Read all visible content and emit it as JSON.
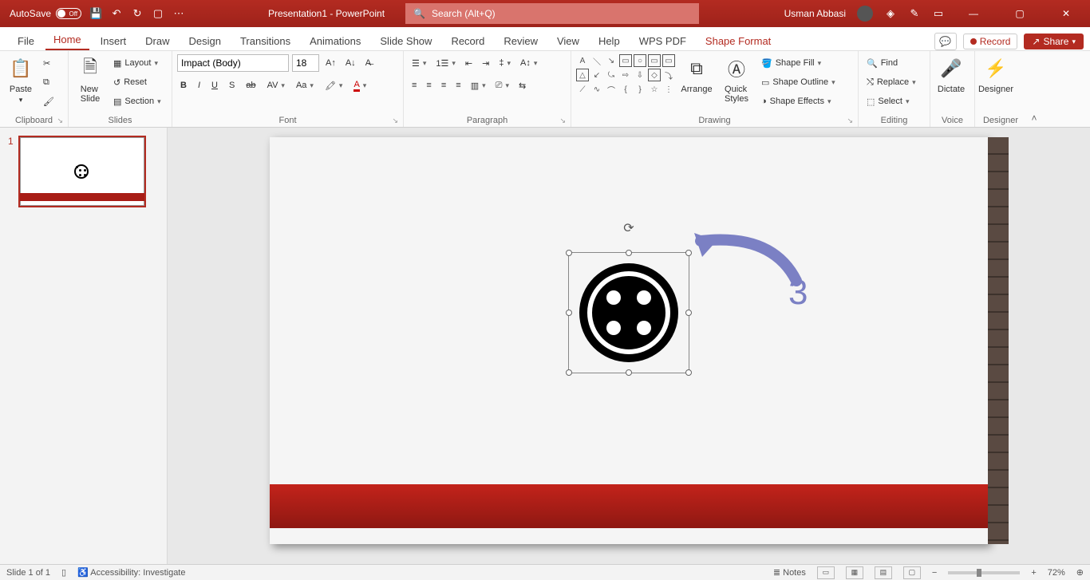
{
  "titlebar": {
    "autosave_label": "AutoSave",
    "autosave_state": "Off",
    "doc_title": "Presentation1 - PowerPoint",
    "search_placeholder": "Search (Alt+Q)",
    "user_name": "Usman Abbasi"
  },
  "tabs": {
    "items": [
      "File",
      "Home",
      "Insert",
      "Draw",
      "Design",
      "Transitions",
      "Animations",
      "Slide Show",
      "Record",
      "Review",
      "View",
      "Help",
      "WPS PDF",
      "Shape Format"
    ],
    "active_index": 1,
    "record_label": "Record",
    "share_label": "Share"
  },
  "ribbon": {
    "clipboard": {
      "label": "Clipboard",
      "paste": "Paste"
    },
    "slides": {
      "label": "Slides",
      "new_slide": "New\nSlide",
      "layout": "Layout",
      "reset": "Reset",
      "section": "Section"
    },
    "font": {
      "label": "Font",
      "family": "Impact (Body)",
      "size": "18"
    },
    "paragraph": {
      "label": "Paragraph"
    },
    "drawing": {
      "label": "Drawing",
      "arrange": "Arrange",
      "quick_styles": "Quick\nStyles",
      "shape_fill": "Shape Fill",
      "shape_outline": "Shape Outline",
      "shape_effects": "Shape Effects"
    },
    "editing": {
      "label": "Editing",
      "find": "Find",
      "replace": "Replace",
      "select": "Select"
    },
    "voice": {
      "label": "Voice",
      "dictate": "Dictate"
    },
    "designer": {
      "label": "Designer",
      "designer": "Designer"
    }
  },
  "thumbs": {
    "slide1_num": "1"
  },
  "annotation": {
    "step": "3"
  },
  "status": {
    "slide_info": "Slide 1 of 1",
    "accessibility": "Accessibility: Investigate",
    "notes": "Notes",
    "zoom": "72%"
  }
}
